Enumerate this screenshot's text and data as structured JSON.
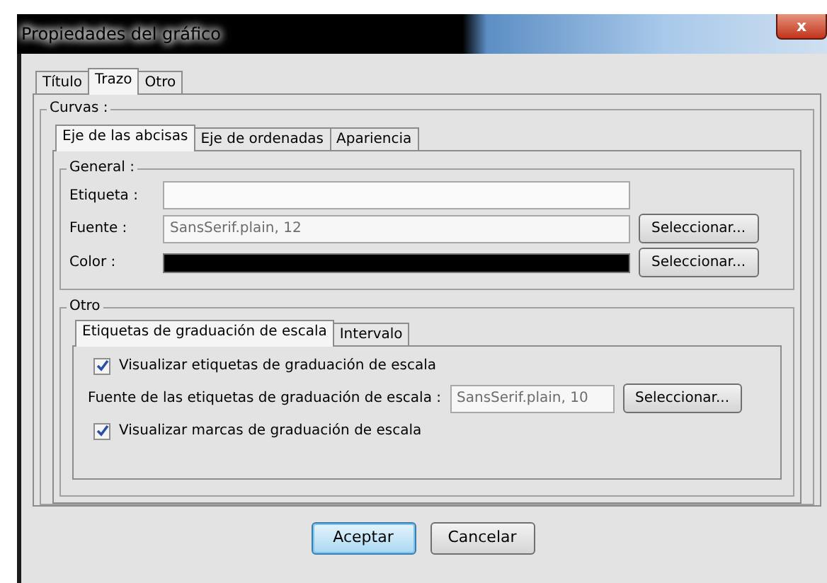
{
  "window": {
    "title": "Propiedades del gráfico",
    "close": "x"
  },
  "tabs": [
    {
      "label": "Título",
      "selected": false
    },
    {
      "label": "Trazo",
      "selected": true
    },
    {
      "label": "Otro",
      "selected": false
    }
  ],
  "curvas": {
    "legend": "Curvas :",
    "tabs": [
      {
        "label": "Eje de las abcisas",
        "selected": true
      },
      {
        "label": "Eje de ordenadas",
        "selected": false
      },
      {
        "label": "Apariencia",
        "selected": false
      }
    ],
    "general": {
      "legend": "General :",
      "rows": [
        {
          "kind": "text",
          "label": "Etiqueta :"
        },
        {
          "kind": "font",
          "label": "Fuente :",
          "value": "SansSerif.plain, 12",
          "button": "Seleccionar..."
        },
        {
          "kind": "color",
          "label": "Color :",
          "color": "#000000",
          "button": "Seleccionar..."
        }
      ]
    },
    "otro": {
      "legend": "Otro",
      "tabs": [
        {
          "label": "Etiquetas de graduación de escala",
          "selected": true
        },
        {
          "label": "Intervalo",
          "selected": false
        }
      ],
      "rows": [
        {
          "kind": "checkbox",
          "label": "Visualizar etiquetas de graduación de escala",
          "checked": true
        },
        {
          "kind": "font",
          "label": "Fuente de las etiquetas de graduación de escala :",
          "value": "SansSerif.plain, 10",
          "button": "Seleccionar..."
        },
        {
          "kind": "checkbox",
          "label": "Visualizar marcas de graduación de escala",
          "checked": true
        }
      ]
    }
  },
  "buttons": [
    {
      "label": "Aceptar",
      "default": true
    },
    {
      "label": "Cancelar",
      "default": false
    }
  ]
}
